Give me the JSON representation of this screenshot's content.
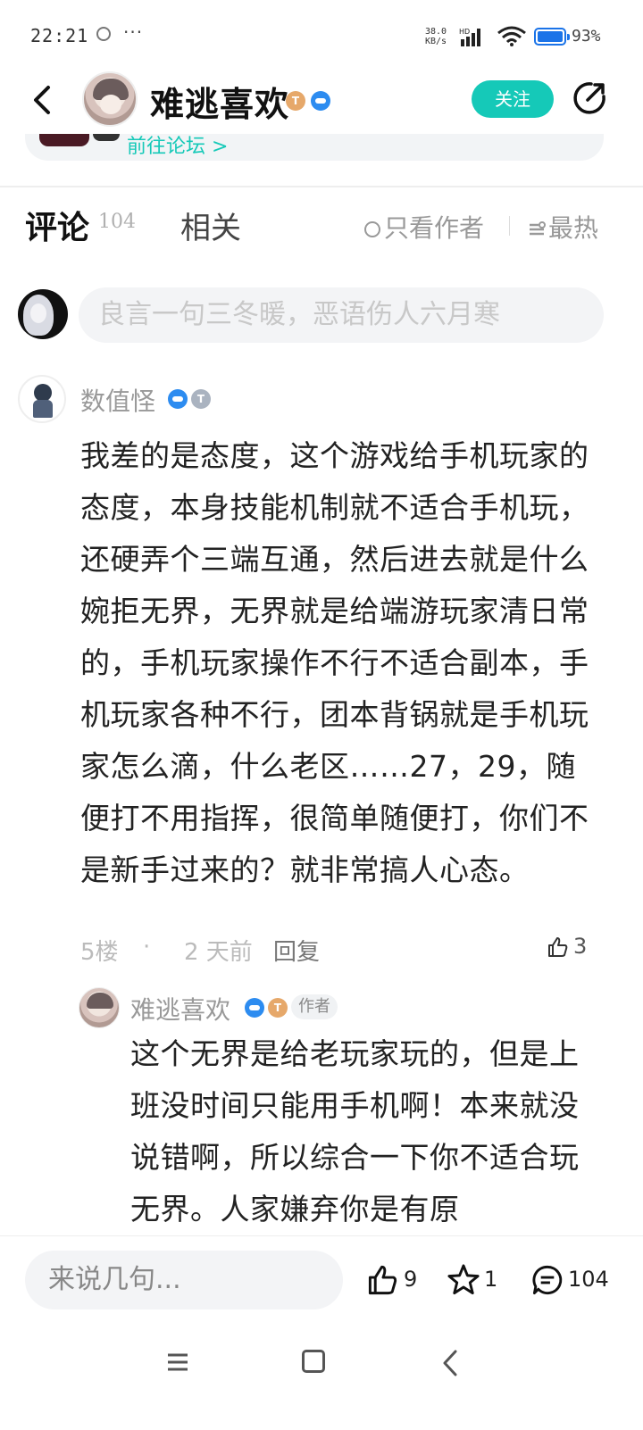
{
  "status_bar": {
    "time": "22:21",
    "dots": "···",
    "speed_value": "38.0",
    "speed_unit": "KB/s",
    "network": "HD",
    "battery": "93%"
  },
  "header": {
    "title": "难逃喜欢",
    "badge_t": "T",
    "follow_label": "关注"
  },
  "forum_strip": {
    "link_text": "前往论坛 >"
  },
  "tabs": {
    "comments_label": "评论",
    "comments_count": "104",
    "related_label": "相关",
    "author_only_label": "只看作者",
    "sort_label": "最热"
  },
  "comment_input": {
    "placeholder": "良言一句三冬暖，恶语伤人六月寒"
  },
  "comments": [
    {
      "username": "数值怪",
      "badge_t": "T",
      "text": "我差的是态度，这个游戏给手机玩家的态度，本身技能机制就不适合手机玩，还硬弄个三端互通，然后进去就是什么婉拒无界，无界就是给端游玩家清日常的，手机玩家操作不行不适合副本，手机玩家各种不行，团本背锅就是手机玩家怎么滴，什么老区……27，29，随便打不用指挥，很简单随便打，你们不是新手过来的？就非常搞人心态。",
      "floor": "5楼",
      "separator": "·",
      "time": "2 天前",
      "reply_label": "回复",
      "likes": "3",
      "reply": {
        "username": "难逃喜欢",
        "badge_t": "T",
        "author_tag": "作者",
        "text": "这个无界是给老玩家玩的，但是上班没时间只能用手机啊！本来就没说错啊，所以综合一下你不适合玩无界。人家嫌弃你是有原"
      }
    }
  ],
  "bottom_bar": {
    "input_placeholder": "来说几句...",
    "likes": "9",
    "favorites": "1",
    "comments": "104"
  },
  "colors": {
    "accent": "#15c9b8",
    "badge_orange": "#e6a86a",
    "badge_blue": "#2d8cf0"
  }
}
